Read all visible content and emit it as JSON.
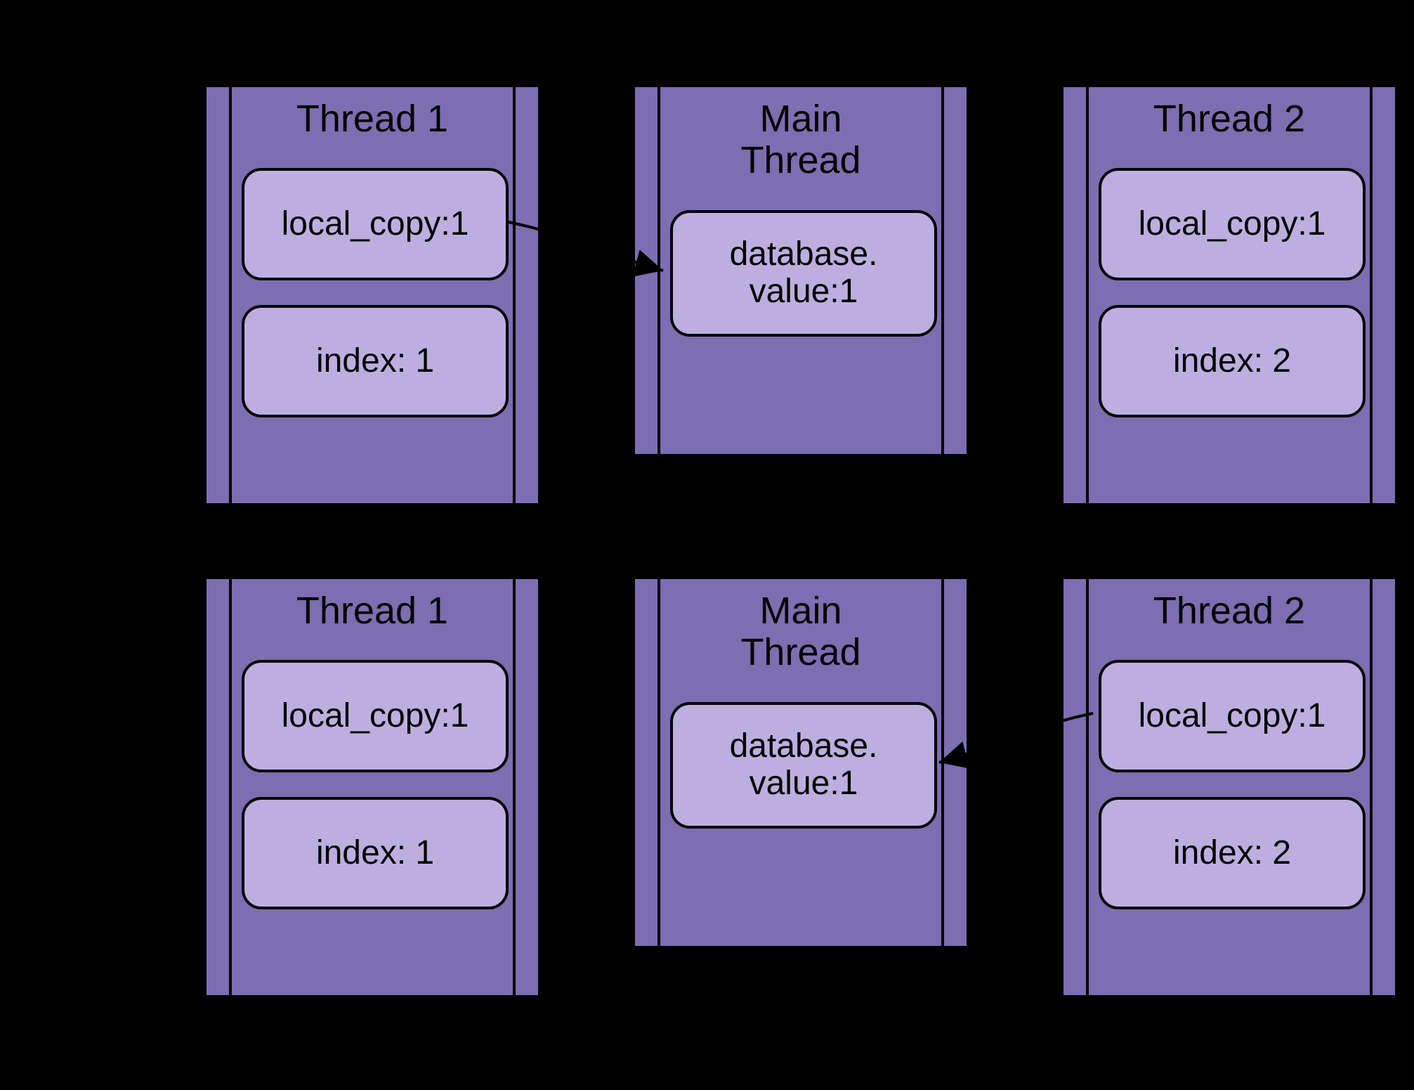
{
  "rows": [
    {
      "thread1": {
        "title": "Thread 1",
        "local_copy": "local_copy:1",
        "index": "index: 1"
      },
      "main": {
        "title": "Main\nThread",
        "value": "database.\nvalue:1"
      },
      "thread2": {
        "title": "Thread 2",
        "local_copy": "local_copy:1",
        "index": "index: 2"
      },
      "arrow": "t1_to_main"
    },
    {
      "thread1": {
        "title": "Thread 1",
        "local_copy": "local_copy:1",
        "index": "index: 1"
      },
      "main": {
        "title": "Main\nThread",
        "value": "database.\nvalue:1"
      },
      "thread2": {
        "title": "Thread 2",
        "local_copy": "local_copy:1",
        "index": "index: 2"
      },
      "arrow": "t2_to_main"
    }
  ],
  "colors": {
    "box_fill": "#7c6eb0",
    "var_fill": "#bcafe0",
    "stroke": "#000000",
    "background": "#000000"
  }
}
